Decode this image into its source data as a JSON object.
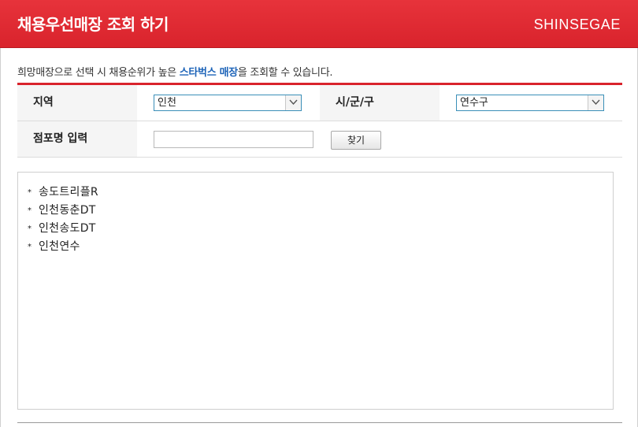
{
  "header": {
    "title": "채용우선매장 조회 하기",
    "brand": "SHINSEGAE"
  },
  "notice": {
    "before": "희망매장으로 선택 시 채용순위가 높은 ",
    "highlight": "스타벅스 매장",
    "after": "을 조회할 수 있습니다."
  },
  "form": {
    "region_label": "지역",
    "region_value": "인천",
    "district_label": "시/군/구",
    "district_value": "연수구",
    "store_label": "점포명 입력",
    "store_input_value": "",
    "find_button": "찾기"
  },
  "results": {
    "bullet": "*",
    "stores": [
      "송도트리플R",
      "인천동춘DT",
      "인천송도DT",
      "인천연수"
    ]
  },
  "icons": {
    "select_arrow": "chevron-down-icon",
    "bullet": "asterisk-icon"
  },
  "colors": {
    "header_red": "#d9232c",
    "highlight_blue": "#1c63b8",
    "select_border": "#3a8fb8"
  }
}
